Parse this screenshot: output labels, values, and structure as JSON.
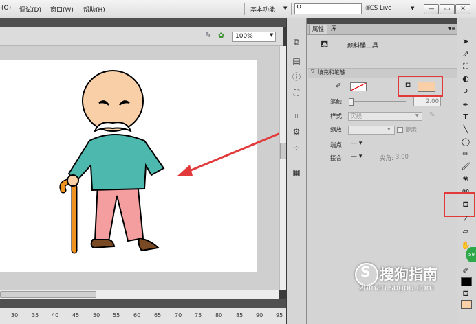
{
  "menu": [
    "(O)",
    "调试(D)",
    "窗口(W)",
    "帮助(H)"
  ],
  "workspace": "基本功能",
  "cs_live": "CS Live",
  "window_buttons": [
    "—",
    "▭",
    "✕"
  ],
  "zoom": "100%",
  "panel": {
    "tabs": [
      "属性",
      "库"
    ],
    "tool_name": "颜料桶工具",
    "section": "填充和笔触",
    "labels": {
      "stroke_width": "笔触:",
      "style": "样式:",
      "scale": "缩放:",
      "hint": "提示",
      "cap": "端点:",
      "join": "接合:",
      "miter": "尖角:"
    },
    "stroke_value": "2.00",
    "style_value": "实线",
    "miter_value": "3.00"
  },
  "ruler": [
    "30",
    "35",
    "40",
    "45",
    "50",
    "55",
    "60",
    "65",
    "70",
    "75",
    "80",
    "85",
    "90",
    "95"
  ],
  "badge": "59",
  "watermark": "搜狗指南",
  "watermark_url": "zhinan.sogou.com",
  "colors": {
    "fill": "#f8cfa7",
    "annotation": "#e23a3a",
    "shirt": "#4db8ae",
    "pants": "#f49ea0",
    "cane": "#f0921e"
  }
}
